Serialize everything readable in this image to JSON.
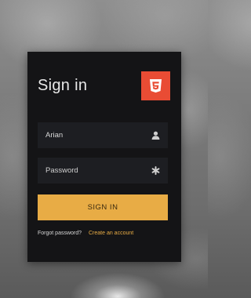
{
  "background": {
    "description_color": "#7a7a7a"
  },
  "card": {
    "title": "Sign in",
    "logo_icon": "html5-shield-icon",
    "logo_color": "#e94c34",
    "username": {
      "value": "Arian",
      "icon": "user-icon"
    },
    "password": {
      "placeholder": "Password",
      "icon": "asterisk-icon"
    },
    "submit_label": "SIGN IN",
    "submit_color": "#e8ac45",
    "forgot_label": "Forgot password?",
    "create_label": "Create an account"
  }
}
